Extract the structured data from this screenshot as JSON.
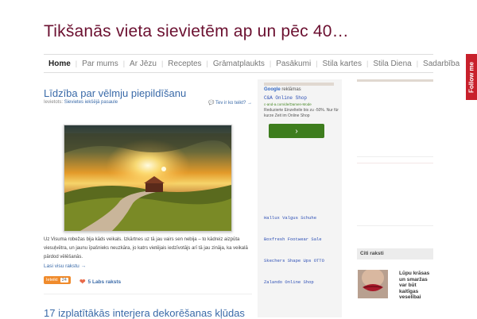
{
  "site": {
    "title": "Tikšanās vieta sievietēm ap un pēc 40…"
  },
  "nav": {
    "items": [
      "Home",
      "Par mums",
      "Ar Jēzu",
      "Receptes",
      "Grāmatplaukts",
      "Pasākumi",
      "Stila kartes",
      "Stila Diena",
      "Sadarbība"
    ],
    "active": 0
  },
  "follow": {
    "label": "Follow me"
  },
  "post": {
    "title": "Līdzība par vēlmju piepildīšanu",
    "meta_prefix": "Ievietots:",
    "category": "Sievietes iekšējā pasaule",
    "comments_link": "Tev ir ko teikt? →",
    "excerpt": "Uz Visuma robežas bija kāds veikals. Izkārtnes uz tā jau vairs sen nebija – to kādreiz aizpūta viesuļvētra, un jaunu īpašnieks neuzkāra, jo katrs vietējais iedzīvotājs arī tā jau zināja, ka veikalā pārdod vēlēšanās.",
    "read_more": "Lasi visu rakstu →",
    "badge_label": "Ieteikt",
    "badge_count": "24",
    "likes": "5 Labs raksts"
  },
  "post2": {
    "title": "17 izplatītākās interjera dekorēšanas kļūdas"
  },
  "ads": {
    "google_label": "Google",
    "google_suffix": "reklāmas",
    "title": "C&A Online Shop",
    "url": "c-and-a.com/de/Damen-Mode",
    "description": "Reduzierte Einzelteile bis zu -50%. Nur für kurze Zeit im Online Shop",
    "button_symbol": "›",
    "links": [
      "Hallux Valgus Schuhe",
      "Boxfresh Footwear Sale",
      "Skechers Shape Ups OTTO",
      "Zalando Online Shop"
    ]
  },
  "sidebar": {
    "citi_header": "Citi raksti",
    "citi_item": "Lūpu krāsas un smaržas var būt kaitīgas veselībai"
  },
  "colors": {
    "title": "#6b1030",
    "link": "#3a6aa8",
    "follow_bg": "#c8202b",
    "ad_button": "#3e7d1e",
    "badge": "#f08b2c"
  }
}
